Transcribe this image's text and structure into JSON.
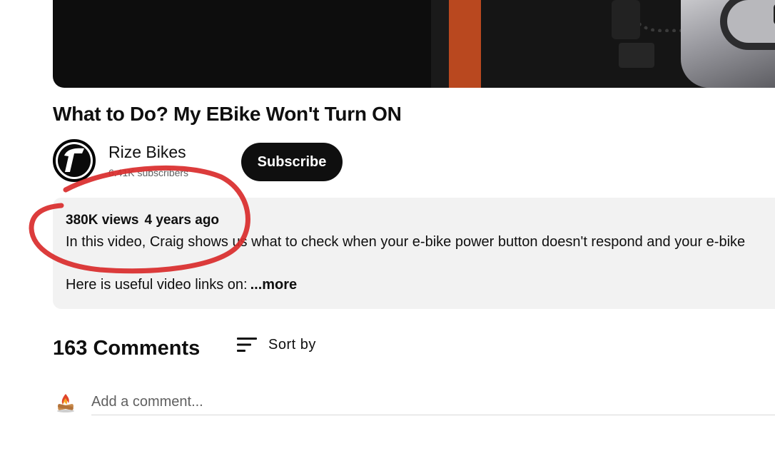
{
  "video": {
    "title": "What to Do? My EBike Won't Turn ON"
  },
  "channel": {
    "name": "Rize Bikes",
    "subscribers": "6.41K subscribers",
    "subscribe_label": "Subscribe"
  },
  "description": {
    "views": "380K views",
    "age": "4 years ago",
    "line1": "In this video, Craig shows us what to check when your e-bike power button doesn't respond and your e-bike",
    "line2": "Here is useful video links on:",
    "more_label": "...more"
  },
  "comments": {
    "count_label": "163 Comments",
    "sort_label": "Sort by",
    "input_placeholder": "Add a comment..."
  },
  "colors": {
    "annotation_circle": "#d92b2b",
    "subscribe_bg": "#0f0f0f",
    "description_bg": "#f2f2f2",
    "player_accent": "#b9481f"
  },
  "icons": {
    "sort": "sort-lines-icon",
    "channel_avatar": "rize-logo-icon",
    "user_avatar": "campfire-avatar-icon"
  }
}
